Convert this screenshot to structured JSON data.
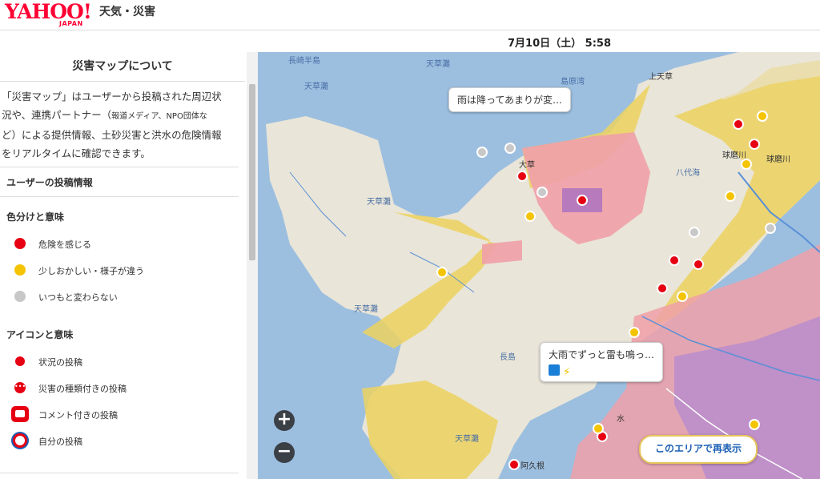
{
  "header": {
    "logo_main": "YAHOO!",
    "logo_sub": "JAPAN",
    "service": "天気・災害"
  },
  "datebar": {
    "date": "7月10日（土） 5:58"
  },
  "sidebar": {
    "title": "災害マップについて",
    "description": [
      "「災害マップ」はユーザーから投稿された周辺状",
      "況や、連携パートナー（",
      "報道メディア、NPO団体な",
      "ど）による提供情報、土砂災害と洪水の危険情報",
      "をリアルタイムに確認できます。"
    ],
    "section_user": "ユーザーの投稿情報",
    "section_colors": "色分けと意味",
    "colors": [
      {
        "label": "危険を感じる",
        "color": "#e60012"
      },
      {
        "label": "少しおかしい・様子が違う",
        "color": "#f5c400"
      },
      {
        "label": "いつもと変わらない",
        "color": "#c8c8c8"
      }
    ],
    "section_icons": "アイコンと意味",
    "icons": [
      {
        "label": "状況の投稿",
        "icon": "red-dot-icon"
      },
      {
        "label": "災害の種類付きの投稿",
        "icon": "red-dots-icon"
      },
      {
        "label": "コメント付きの投稿",
        "icon": "comment-icon"
      },
      {
        "label": "自分の投稿",
        "icon": "self-post-icon"
      }
    ]
  },
  "map": {
    "bubble1": "雨は降ってあまりが変…",
    "bubble2": "大雨でずっと雷も鳴っ…",
    "reload": "このエリアで再表示",
    "zoom_in": "+",
    "zoom_out": "−",
    "places": [
      "長崎半島",
      "天草灘",
      "天草灘",
      "島原湾",
      "上天草",
      "八代海",
      "天草灘",
      "天草灘",
      "大草",
      "球磨川",
      "球磨川",
      "阿久根",
      "水",
      "長島",
      "天草灘"
    ]
  },
  "colors": {
    "danger": "#e60012",
    "warning": "#f5c400",
    "normal": "#c8c8c8",
    "accent": "#ff0033"
  }
}
